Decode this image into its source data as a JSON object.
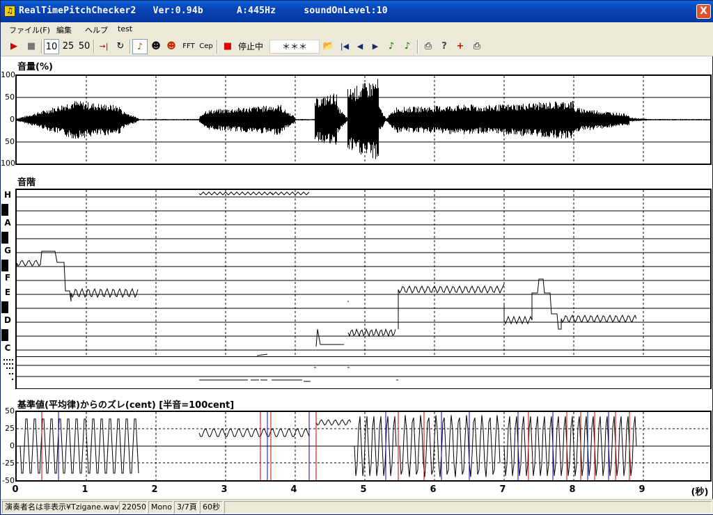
{
  "window": {
    "title": "RealTimePitchChecker2   Ver:0.94b      A:445Hz     soundOnLevel:10",
    "icon": "tuning-fork-icon",
    "close_label": "X"
  },
  "menu": {
    "items": [
      "ファイル(F)",
      "編集",
      "ヘルプ",
      "test"
    ]
  },
  "toolbar": {
    "play": "▶",
    "stop": "■",
    "z10": "10",
    "z25": "25",
    "z50": "50",
    "to_end": "→|",
    "loop": "↻",
    "violin": "♪",
    "person1": "☻",
    "person2": "☻",
    "fft": "FFT",
    "cep": "Cep",
    "rec": "■",
    "state": "停止中",
    "note_display": "＊＊＊",
    "open": "📂",
    "first": "|◀",
    "prev": "◀",
    "next": "▶",
    "note1": "♪",
    "note2": "♪",
    "print": "⎙",
    "help": "?",
    "plus": "+",
    "print2": "⎙"
  },
  "volume_panel": {
    "title": "音量(%)",
    "yticks": [
      "100",
      "50",
      "0",
      "50",
      "100"
    ]
  },
  "pitch_panel": {
    "title": "音階",
    "notes": [
      "H",
      "A",
      "G",
      "F",
      "E",
      "D",
      "C"
    ]
  },
  "cent_panel": {
    "title": "基準値(平均律)からのズレ(cent) [半音=100cent]",
    "yticks": [
      "50",
      "25",
      "0",
      "-25",
      "-50"
    ]
  },
  "time_axis": {
    "ticks": [
      "0",
      "1",
      "2",
      "3",
      "4",
      "5",
      "6",
      "7",
      "8",
      "9"
    ],
    "unit": "(秒)"
  },
  "statusbar": {
    "file": "演奏者名は非表示¥Tzigane.wav",
    "rate": "22050",
    "channels": "Mono",
    "page": "3/7頁",
    "length": "60秒"
  },
  "colors": {
    "title_bar": "#0843b6",
    "chrome": "#ece9d8",
    "deviation_red": "#cc0000",
    "deviation_blue": "#0000cc"
  }
}
